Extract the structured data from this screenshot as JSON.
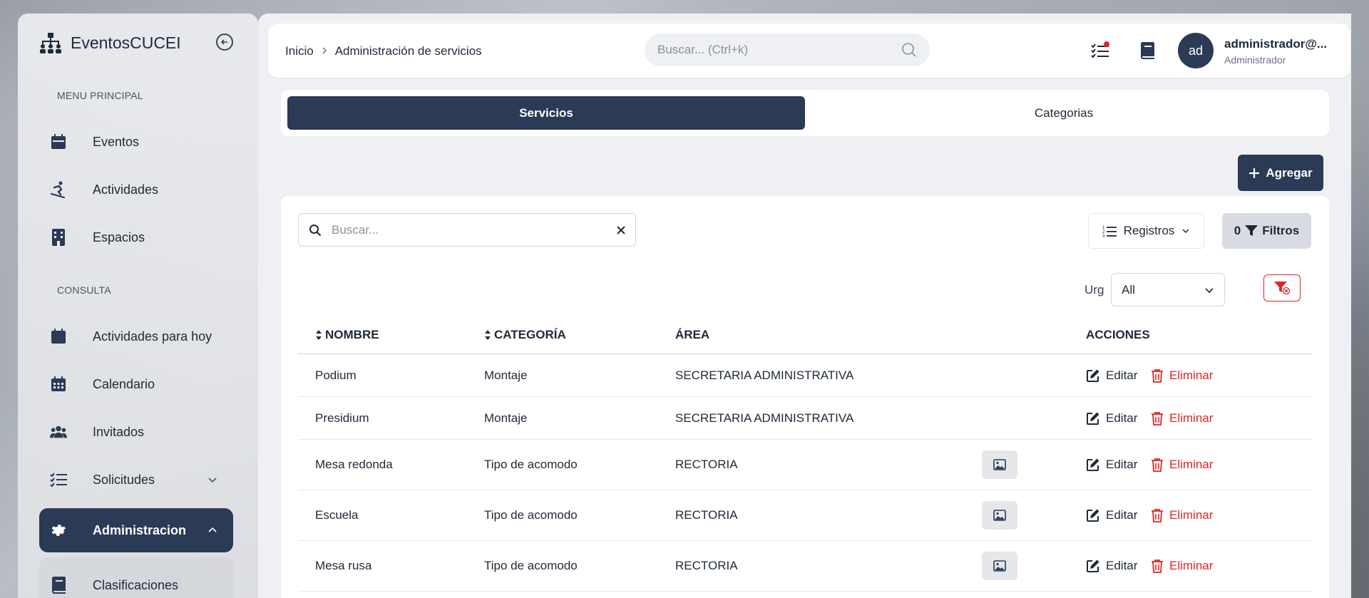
{
  "brand": {
    "name": "EventosCUCEI"
  },
  "sidebar": {
    "section_main": "MENU PRINCIPAL",
    "section_consulta": "CONSULTA",
    "items": [
      {
        "label": "Eventos",
        "icon": "calendar-icon"
      },
      {
        "label": "Actividades",
        "icon": "snowboard-icon"
      },
      {
        "label": "Espacios",
        "icon": "building-icon"
      },
      {
        "label": "Actividades para hoy",
        "icon": "calendar-today-icon"
      },
      {
        "label": "Calendario",
        "icon": "calendar-grid-icon"
      },
      {
        "label": "Invitados",
        "icon": "users-icon"
      },
      {
        "label": "Solicitudes",
        "icon": "checklist-icon"
      },
      {
        "label": "Administracion",
        "icon": "gear-icon"
      },
      {
        "label": "Clasificaciones",
        "icon": "book-icon"
      }
    ]
  },
  "header": {
    "breadcrumb": [
      "Inicio",
      "Administración de servicios"
    ],
    "search_placeholder": "Buscar... (Ctrl+k)",
    "avatar_initials": "ad",
    "user_name": "administrador@...",
    "user_role": "Administrador"
  },
  "tabs": [
    {
      "label": "Servicios",
      "active": true
    },
    {
      "label": "Categorias",
      "active": false
    }
  ],
  "toolbar": {
    "add_label": "Agregar",
    "search_placeholder": "Buscar...",
    "registros_label": "Registros",
    "filtros_count": "0",
    "filtros_label": "Filtros",
    "urg_label": "Urg",
    "urg_value": "All"
  },
  "table": {
    "headers": [
      "NOMBRE",
      "CATEGORÍA",
      "ÁREA",
      "ACCIONES"
    ],
    "edit_label": "Editar",
    "delete_label": "Eliminar",
    "rows": [
      {
        "nombre": "Podium",
        "categoria": "Montaje",
        "area": "SECRETARIA ADMINISTRATIVA",
        "has_image": false
      },
      {
        "nombre": "Presidium",
        "categoria": "Montaje",
        "area": "SECRETARIA ADMINISTRATIVA",
        "has_image": false
      },
      {
        "nombre": "Mesa redonda",
        "categoria": "Tipo de acomodo",
        "area": "RECTORIA",
        "has_image": true
      },
      {
        "nombre": "Escuela",
        "categoria": "Tipo de acomodo",
        "area": "RECTORIA",
        "has_image": true
      },
      {
        "nombre": "Mesa rusa",
        "categoria": "Tipo de acomodo",
        "area": "RECTORIA",
        "has_image": true
      }
    ]
  },
  "colors": {
    "primary": "#2b3a55",
    "danger": "#dc2626",
    "notification_dot": "#dc2626"
  }
}
